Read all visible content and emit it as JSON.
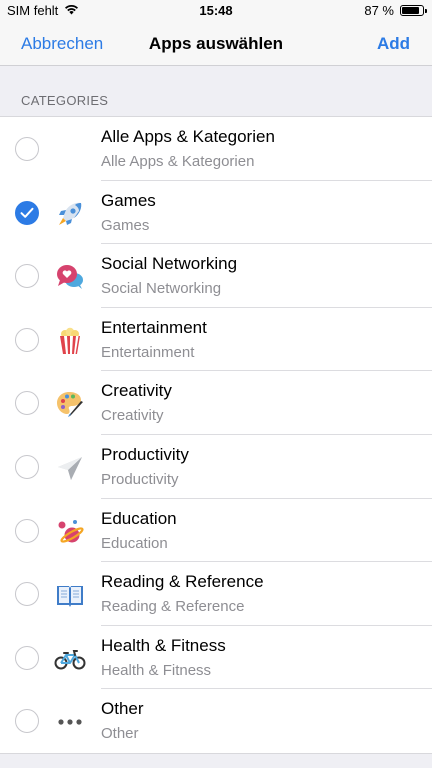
{
  "status": {
    "carrier": "SIM fehlt",
    "time": "15:48",
    "battery": "87 %",
    "battery_level": 0.87
  },
  "nav": {
    "cancel": "Abbrechen",
    "title": "Apps auswählen",
    "add": "Add"
  },
  "section": {
    "header": "CATEGORIES"
  },
  "rows": [
    {
      "title": "Alle Apps & Kategorien",
      "subtitle": "Alle Apps & Kategorien",
      "icon": "none",
      "checked": false
    },
    {
      "title": "Games",
      "subtitle": "Games",
      "icon": "rocket-icon",
      "checked": true
    },
    {
      "title": "Social Networking",
      "subtitle": "Social Networking",
      "icon": "chat-heart-icon",
      "checked": false
    },
    {
      "title": "Entertainment",
      "subtitle": "Entertainment",
      "icon": "popcorn-icon",
      "checked": false
    },
    {
      "title": "Creativity",
      "subtitle": "Creativity",
      "icon": "palette-icon",
      "checked": false
    },
    {
      "title": "Productivity",
      "subtitle": "Productivity",
      "icon": "paper-plane-icon",
      "checked": false
    },
    {
      "title": "Education",
      "subtitle": "Education",
      "icon": "planet-icon",
      "checked": false
    },
    {
      "title": "Reading & Reference",
      "subtitle": "Reading & Reference",
      "icon": "book-icon",
      "checked": false
    },
    {
      "title": "Health & Fitness",
      "subtitle": "Health & Fitness",
      "icon": "bicycle-icon",
      "checked": false
    },
    {
      "title": "Other",
      "subtitle": "Other",
      "icon": "more-dots-icon",
      "checked": false
    }
  ],
  "colors": {
    "accent": "#2c7be5",
    "background": "#efeff4",
    "secondary_text": "#8e8e93"
  }
}
